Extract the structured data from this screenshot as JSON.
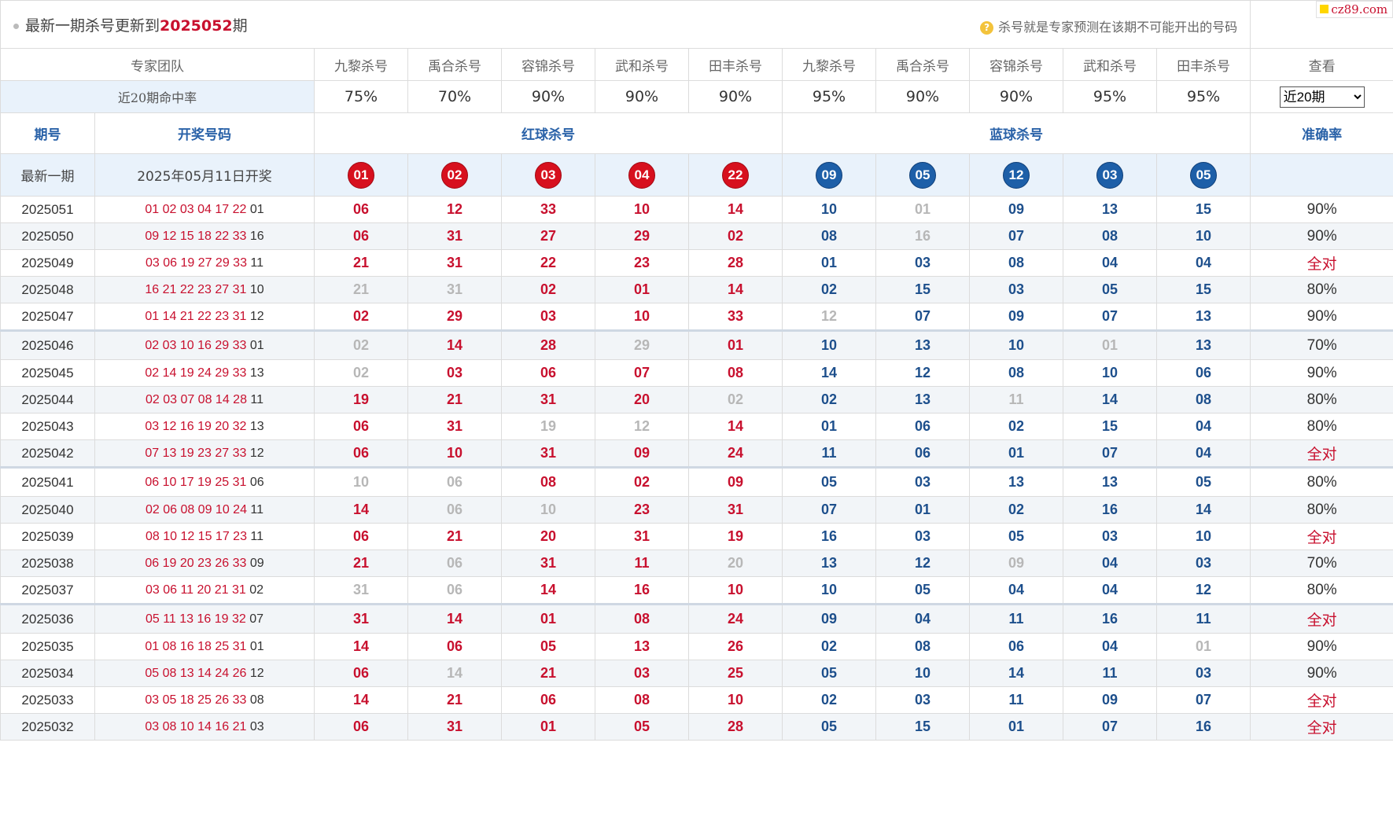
{
  "header": {
    "title_prefix": "最新一期杀号更新到",
    "title_issue": "2025052",
    "title_suffix": "期",
    "note": "杀号就是专家预测在该期不可能开出的号码",
    "logo": "cz89.com"
  },
  "columns": {
    "team_label": "专家团队",
    "experts": [
      "九黎杀号",
      "禹合杀号",
      "容锦杀号",
      "武和杀号",
      "田丰杀号",
      "九黎杀号",
      "禹合杀号",
      "容锦杀号",
      "武和杀号",
      "田丰杀号"
    ],
    "view_label": "查看"
  },
  "hit_rate": {
    "label": "近20期命中率",
    "values": [
      "75%",
      "70%",
      "90%",
      "90%",
      "90%",
      "95%",
      "90%",
      "90%",
      "95%",
      "95%"
    ],
    "select_value": "近20期"
  },
  "section": {
    "issue": "期号",
    "draw": "开奖号码",
    "red": "红球杀号",
    "blue": "蓝球杀号",
    "accuracy": "准确率"
  },
  "latest": {
    "label": "最新一期",
    "date": "2025年05月11日开奖",
    "red_kills": [
      "01",
      "02",
      "03",
      "04",
      "22"
    ],
    "blue_kills": [
      "09",
      "05",
      "12",
      "03",
      "05"
    ]
  },
  "colors": {
    "red": "#c8102e",
    "blue": "#1d4f8c",
    "miss": "#b7b7b7",
    "header_bg": "#e9f2fb"
  },
  "rows": [
    {
      "issue": "2025051",
      "red": "01 02 03 04 17 22",
      "blue": "01",
      "kills": [
        "06",
        "12",
        "33",
        "10",
        "14",
        "10",
        "01",
        "09",
        "13",
        "15"
      ],
      "miss": [
        6
      ],
      "acc": "90%"
    },
    {
      "issue": "2025050",
      "red": "09 12 15 18 22 33",
      "blue": "16",
      "kills": [
        "06",
        "31",
        "27",
        "29",
        "02",
        "08",
        "16",
        "07",
        "08",
        "10"
      ],
      "miss": [
        6
      ],
      "acc": "90%"
    },
    {
      "issue": "2025049",
      "red": "03 06 19 27 29 33",
      "blue": "11",
      "kills": [
        "21",
        "31",
        "22",
        "23",
        "28",
        "01",
        "03",
        "08",
        "04",
        "04"
      ],
      "miss": [],
      "acc": "全对"
    },
    {
      "issue": "2025048",
      "red": "16 21 22 23 27 31",
      "blue": "10",
      "kills": [
        "21",
        "31",
        "02",
        "01",
        "14",
        "02",
        "15",
        "03",
        "05",
        "15"
      ],
      "miss": [
        0,
        1
      ],
      "acc": "80%"
    },
    {
      "issue": "2025047",
      "red": "01 14 21 22 23 31",
      "blue": "12",
      "kills": [
        "02",
        "29",
        "03",
        "10",
        "33",
        "12",
        "07",
        "09",
        "07",
        "13"
      ],
      "miss": [
        5
      ],
      "acc": "90%"
    },
    {
      "issue": "2025046",
      "red": "02 03 10 16 29 33",
      "blue": "01",
      "kills": [
        "02",
        "14",
        "28",
        "29",
        "01",
        "10",
        "13",
        "10",
        "01",
        "13"
      ],
      "miss": [
        0,
        3,
        8
      ],
      "acc": "70%"
    },
    {
      "issue": "2025045",
      "red": "02 14 19 24 29 33",
      "blue": "13",
      "kills": [
        "02",
        "03",
        "06",
        "07",
        "08",
        "14",
        "12",
        "08",
        "10",
        "06"
      ],
      "miss": [
        0
      ],
      "acc": "90%"
    },
    {
      "issue": "2025044",
      "red": "02 03 07 08 14 28",
      "blue": "11",
      "kills": [
        "19",
        "21",
        "31",
        "20",
        "02",
        "02",
        "13",
        "11",
        "14",
        "08"
      ],
      "miss": [
        4,
        7
      ],
      "acc": "80%"
    },
    {
      "issue": "2025043",
      "red": "03 12 16 19 20 32",
      "blue": "13",
      "kills": [
        "06",
        "31",
        "19",
        "12",
        "14",
        "01",
        "06",
        "02",
        "15",
        "04"
      ],
      "miss": [
        2,
        3
      ],
      "acc": "80%"
    },
    {
      "issue": "2025042",
      "red": "07 13 19 23 27 33",
      "blue": "12",
      "kills": [
        "06",
        "10",
        "31",
        "09",
        "24",
        "11",
        "06",
        "01",
        "07",
        "04"
      ],
      "miss": [],
      "acc": "全对"
    },
    {
      "issue": "2025041",
      "red": "06 10 17 19 25 31",
      "blue": "06",
      "kills": [
        "10",
        "06",
        "08",
        "02",
        "09",
        "05",
        "03",
        "13",
        "13",
        "05"
      ],
      "miss": [
        0,
        1
      ],
      "acc": "80%"
    },
    {
      "issue": "2025040",
      "red": "02 06 08 09 10 24",
      "blue": "11",
      "kills": [
        "14",
        "06",
        "10",
        "23",
        "31",
        "07",
        "01",
        "02",
        "16",
        "14"
      ],
      "miss": [
        1,
        2
      ],
      "acc": "80%"
    },
    {
      "issue": "2025039",
      "red": "08 10 12 15 17 23",
      "blue": "11",
      "kills": [
        "06",
        "21",
        "20",
        "31",
        "19",
        "16",
        "03",
        "05",
        "03",
        "10"
      ],
      "miss": [],
      "acc": "全对"
    },
    {
      "issue": "2025038",
      "red": "06 19 20 23 26 33",
      "blue": "09",
      "kills": [
        "21",
        "06",
        "31",
        "11",
        "20",
        "13",
        "12",
        "09",
        "04",
        "03"
      ],
      "miss": [
        1,
        4,
        7
      ],
      "acc": "70%"
    },
    {
      "issue": "2025037",
      "red": "03 06 11 20 21 31",
      "blue": "02",
      "kills": [
        "31",
        "06",
        "14",
        "16",
        "10",
        "10",
        "05",
        "04",
        "04",
        "12"
      ],
      "miss": [
        0,
        1
      ],
      "acc": "80%"
    },
    {
      "issue": "2025036",
      "red": "05 11 13 16 19 32",
      "blue": "07",
      "kills": [
        "31",
        "14",
        "01",
        "08",
        "24",
        "09",
        "04",
        "11",
        "16",
        "11"
      ],
      "miss": [],
      "acc": "全对"
    },
    {
      "issue": "2025035",
      "red": "01 08 16 18 25 31",
      "blue": "01",
      "kills": [
        "14",
        "06",
        "05",
        "13",
        "26",
        "02",
        "08",
        "06",
        "04",
        "01"
      ],
      "miss": [
        9
      ],
      "acc": "90%"
    },
    {
      "issue": "2025034",
      "red": "05 08 13 14 24 26",
      "blue": "12",
      "kills": [
        "06",
        "14",
        "21",
        "03",
        "25",
        "05",
        "10",
        "14",
        "11",
        "03"
      ],
      "miss": [
        1
      ],
      "acc": "90%"
    },
    {
      "issue": "2025033",
      "red": "03 05 18 25 26 33",
      "blue": "08",
      "kills": [
        "14",
        "21",
        "06",
        "08",
        "10",
        "02",
        "03",
        "11",
        "09",
        "07"
      ],
      "miss": [],
      "acc": "全对"
    },
    {
      "issue": "2025032",
      "red": "03 08 10 14 16 21",
      "blue": "03",
      "kills": [
        "06",
        "31",
        "01",
        "05",
        "28",
        "05",
        "15",
        "01",
        "07",
        "16"
      ],
      "miss": [],
      "acc": "全对"
    }
  ]
}
